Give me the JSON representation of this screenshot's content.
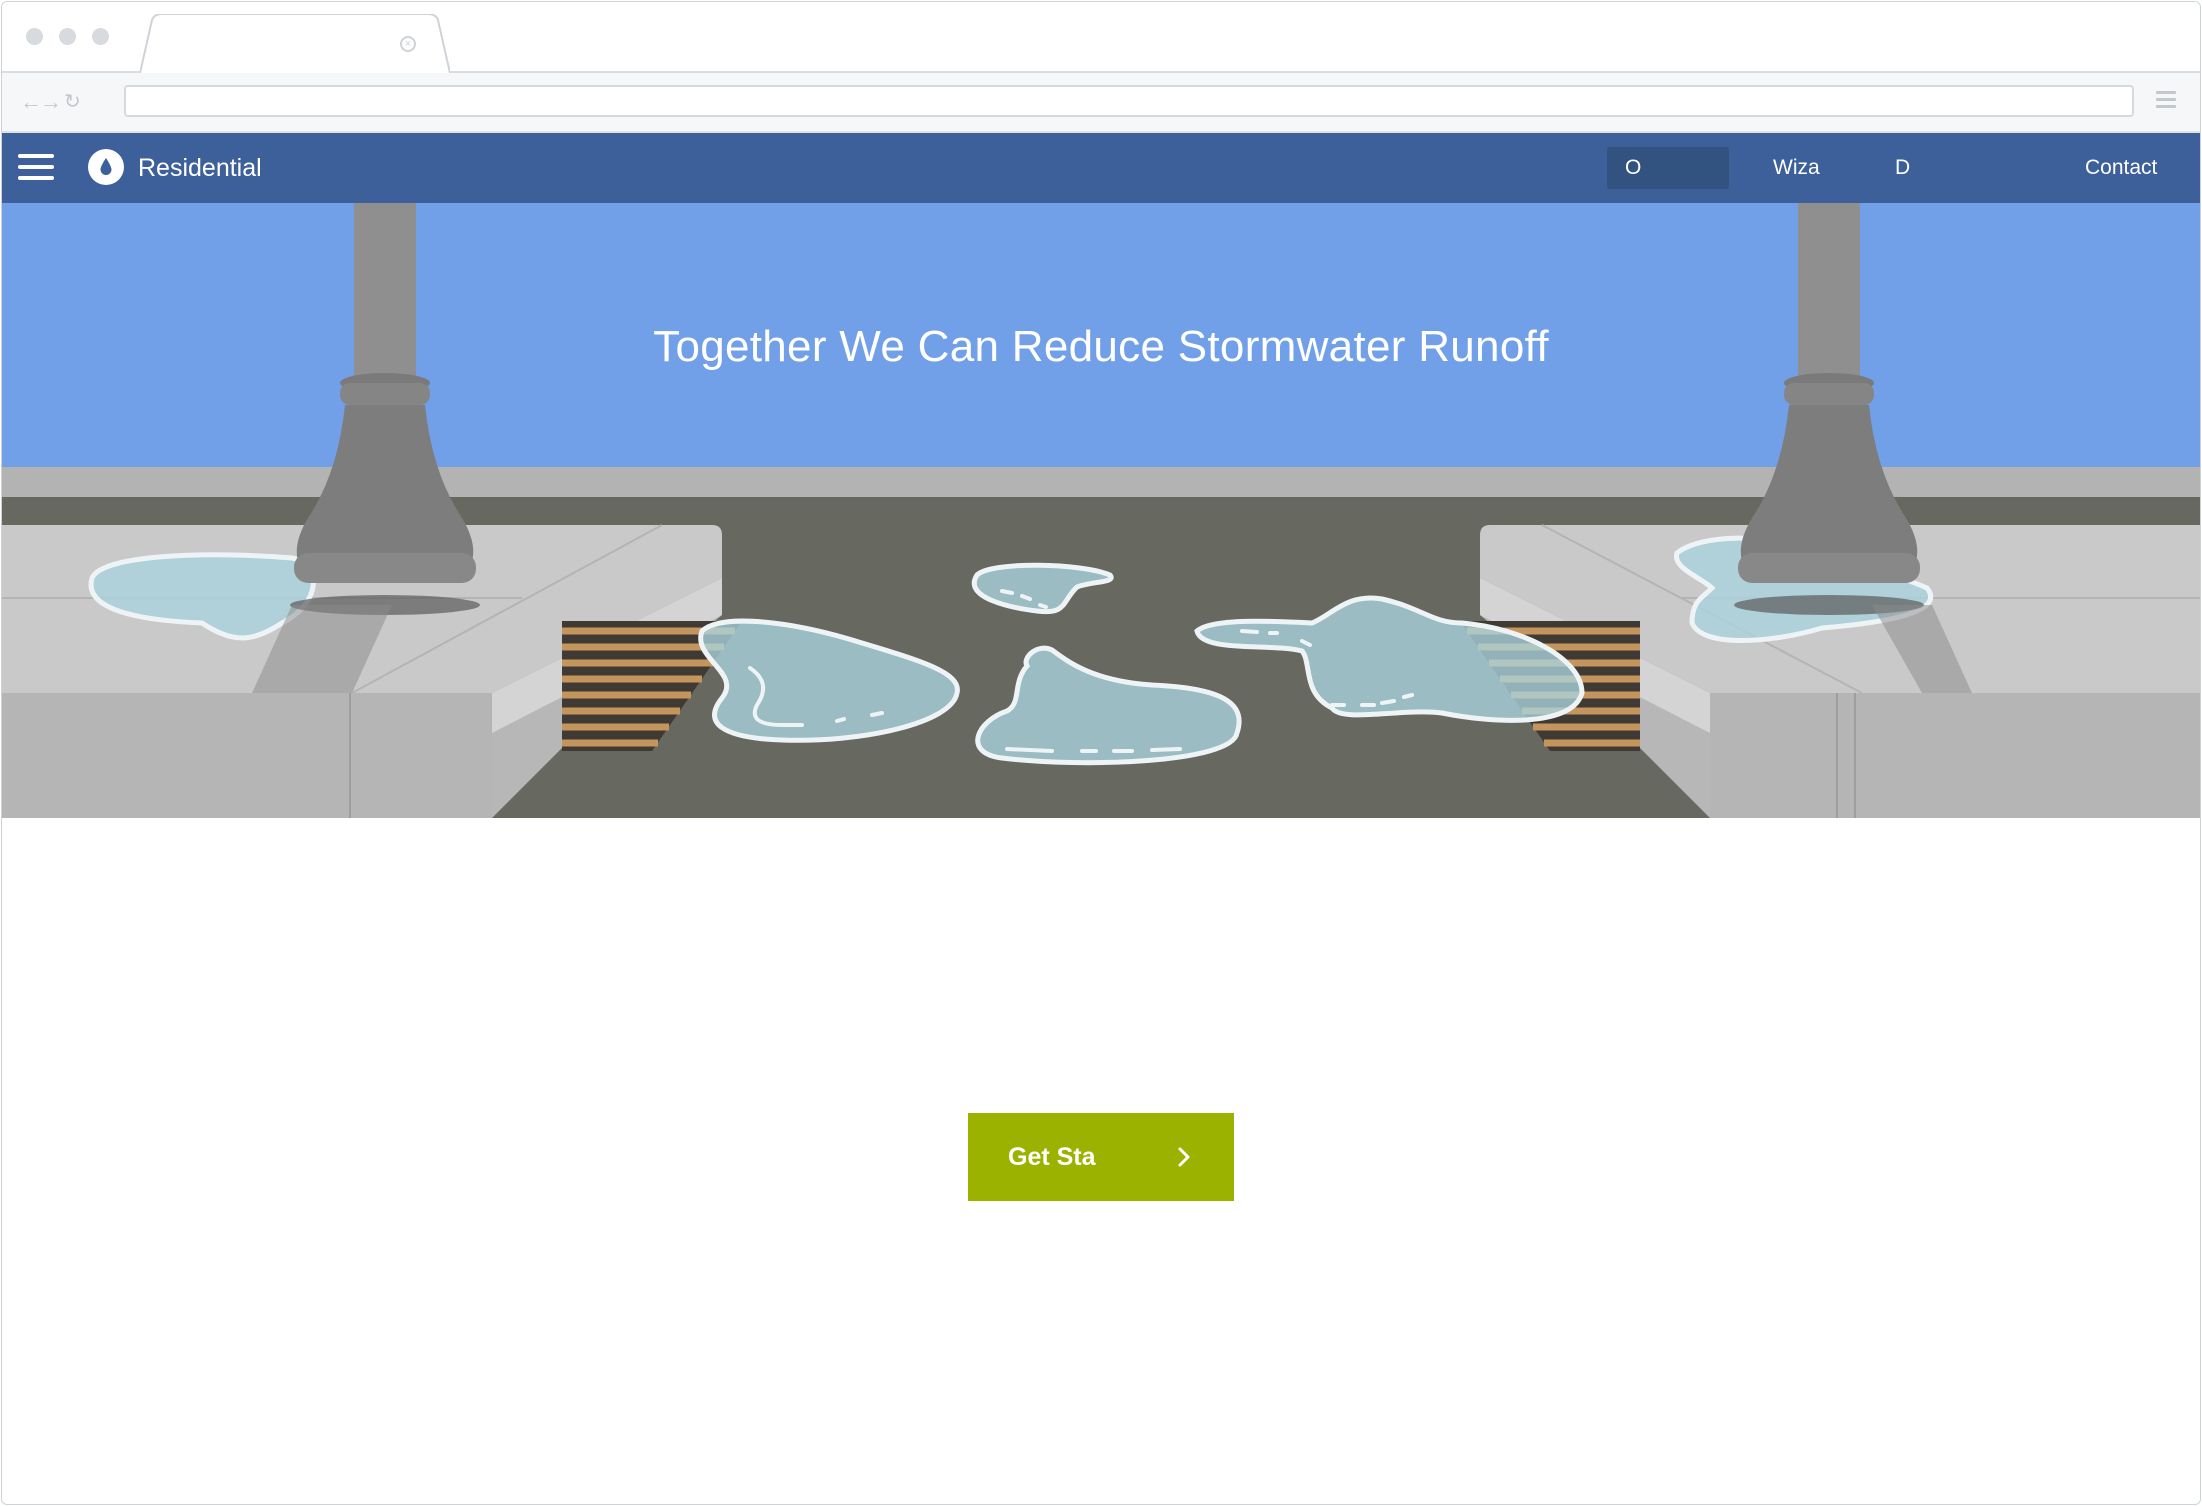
{
  "browser": {
    "tab_title": "",
    "url": "",
    "colors": {
      "chrome_bg": "#ffffff",
      "address_bg": "#f6f7f8",
      "dot": "#d7dade"
    }
  },
  "nav": {
    "brand": "Residential",
    "items": [
      {
        "label": "O",
        "active": true
      },
      {
        "label": "Wiza",
        "active": false
      },
      {
        "label": "D",
        "active": false
      },
      {
        "label": "Contact",
        "active": false
      }
    ],
    "colors": {
      "bar": "#3d5f9a",
      "active_item": "#32527f"
    },
    "icons": {
      "menu": "hamburger-icon",
      "logo": "water-drop-icon"
    }
  },
  "hero": {
    "title": "Together We Can Reduce Stormwater Runoff",
    "colors": {
      "sky": "#72a0e8",
      "road": "#67685f",
      "sidewalk": "#c8c8c8",
      "puddle": "#a9d3de",
      "lamp": "#8c8c8c"
    }
  },
  "cta": {
    "label": "Get Sta",
    "icon": "chevron-right-icon",
    "color": "#9bb300"
  }
}
